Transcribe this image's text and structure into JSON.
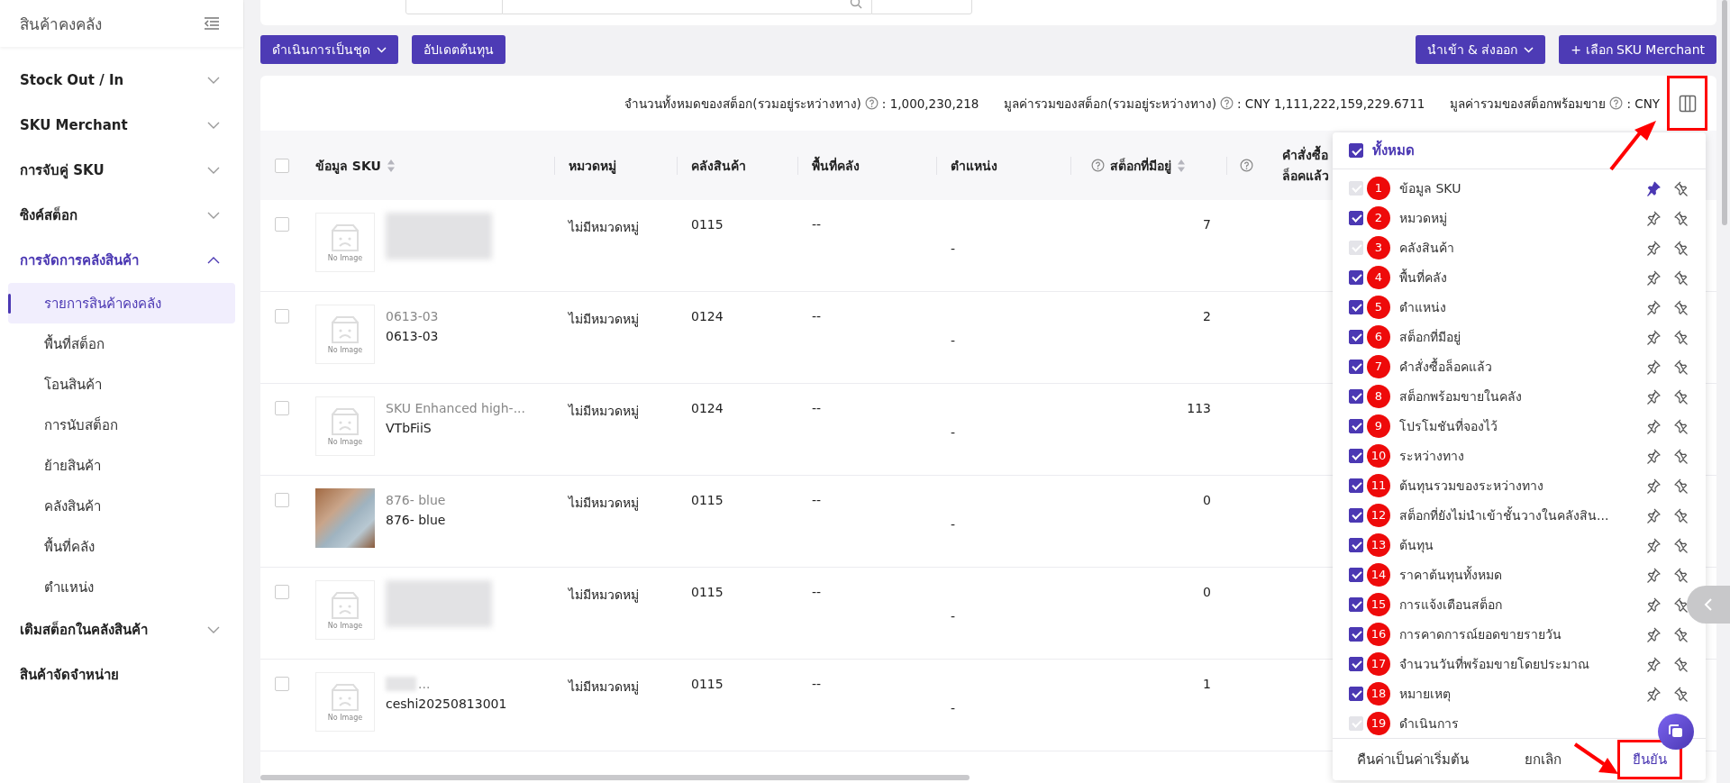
{
  "sidebar": {
    "title": "สินค้าคงคลัง",
    "items": [
      {
        "label": "Stock Out / In",
        "kind": "group",
        "expanded": false,
        "selected": false
      },
      {
        "label": "SKU Merchant",
        "kind": "group",
        "expanded": false,
        "selected": false
      },
      {
        "label": "การจับคู่ SKU",
        "kind": "group",
        "expanded": false,
        "selected": false
      },
      {
        "label": "ซิงค์สต็อก",
        "kind": "group",
        "expanded": false,
        "selected": false
      },
      {
        "label": "การจัดการคลังสินค้า",
        "kind": "group",
        "expanded": true,
        "selected": true,
        "children": [
          {
            "label": "รายการสินค้าคงคลัง",
            "selected": true
          },
          {
            "label": "พื้นที่สต็อก",
            "selected": false
          },
          {
            "label": "โอนสินค้า",
            "selected": false
          },
          {
            "label": "การนับสต็อก",
            "selected": false
          },
          {
            "label": "ย้ายสินค้า",
            "selected": false
          },
          {
            "label": "คลังสินค้า",
            "selected": false
          },
          {
            "label": "พื้นที่คลัง",
            "selected": false
          },
          {
            "label": "ตำแหน่ง",
            "selected": false
          }
        ]
      },
      {
        "label": "เติมสต็อกในคลังสินค้า",
        "kind": "group",
        "expanded": false,
        "selected": false
      },
      {
        "label": "สินค้าจัดจำหน่าย",
        "kind": "link",
        "selected": false
      }
    ]
  },
  "toolbar": {
    "left": [
      {
        "label": "ดำเนินการเป็นชุด",
        "dropdown": true
      },
      {
        "label": "อัปเดตต้นทุน",
        "dropdown": false
      }
    ],
    "right": [
      {
        "label": "นำเข้า & ส่งออก",
        "dropdown": true
      },
      {
        "label": "+ เลือก SKU Merchant",
        "dropdown": false
      }
    ]
  },
  "summary": [
    {
      "label": "จำนวนทั้งหมดของสต็อก(รวมอยู่ระหว่างทาง)",
      "value": ": 1,000,230,218"
    },
    {
      "label": "มูลค่ารวมของสต็อก(รวมอยู่ระหว่างทาง)",
      "value": ": CNY 1,111,222,159,229.6711"
    },
    {
      "label": "มูลค่ารวมของสต็อกพร้อมขาย",
      "value": ": CNY"
    }
  ],
  "column_settings_button": {
    "highlighted": true
  },
  "table": {
    "all_selected": false,
    "columns": [
      {
        "label": "ข้อมูล SKU",
        "help": false,
        "sortable": true
      },
      {
        "label": "หมวดหมู่",
        "help": false,
        "sortable": false
      },
      {
        "label": "คลังสินค้า",
        "help": false,
        "sortable": false
      },
      {
        "label": "พื้นที่คลัง",
        "help": false,
        "sortable": false
      },
      {
        "label": "ตำแหน่ง",
        "help": false,
        "sortable": false
      },
      {
        "label": "สต็อกที่มีอยู่",
        "help": true,
        "sortable": true
      },
      {
        "label": "คำสั่งซื้อล็อคแล้ว",
        "help": true,
        "sortable": false
      }
    ],
    "rows": [
      {
        "image": {
          "kind": "placeholder",
          "label": "No Image"
        },
        "title": {
          "kind": "blurred"
        },
        "category": "ไม่มีหมวดหมู่",
        "warehouse": "0115",
        "area": "--",
        "position": "-",
        "stock": "7",
        "selected": false
      },
      {
        "image": {
          "kind": "placeholder",
          "label": "No Image"
        },
        "title": {
          "kind": "text",
          "code": "0613-03",
          "name": "0613-03"
        },
        "category": "ไม่มีหมวดหมู่",
        "warehouse": "0124",
        "area": "--",
        "position": "-",
        "stock": "2",
        "selected": false
      },
      {
        "image": {
          "kind": "placeholder",
          "label": "No Image"
        },
        "title": {
          "kind": "text",
          "code": "SKU Enhanced high-...",
          "name": "VTbFiiS"
        },
        "category": "ไม่มีหมวดหมู่",
        "warehouse": "0124",
        "area": "--",
        "position": "-",
        "stock": "113",
        "selected": false
      },
      {
        "image": {
          "kind": "photo"
        },
        "title": {
          "kind": "text",
          "code": "876- blue",
          "name": "876- blue"
        },
        "category": "ไม่มีหมวดหมู่",
        "warehouse": "0115",
        "area": "--",
        "position": "-",
        "stock": "0",
        "selected": false
      },
      {
        "image": {
          "kind": "placeholder",
          "label": "No Image"
        },
        "title": {
          "kind": "blurred"
        },
        "category": "ไม่มีหมวดหมู่",
        "warehouse": "0115",
        "area": "--",
        "position": "-",
        "stock": "0",
        "selected": false
      },
      {
        "image": {
          "kind": "placeholder",
          "label": "No Image"
        },
        "title": {
          "kind": "blurred_prefix",
          "code": "...",
          "name": "ceshi20250813001"
        },
        "category": "ไม่มีหมวดหมู่",
        "warehouse": "0115",
        "area": "--",
        "position": "-",
        "stock": "1",
        "selected": false
      }
    ]
  },
  "column_panel": {
    "all_label": "ทั้งหมด",
    "all_checked": true,
    "items": [
      {
        "badge": "1",
        "label": "ข้อมูล SKU",
        "checked": true,
        "disabled": true,
        "pinned": true
      },
      {
        "badge": "2",
        "label": "หมวดหมู่",
        "checked": true,
        "disabled": false,
        "pinned": false
      },
      {
        "badge": "3",
        "label": "คลังสินค้า",
        "checked": true,
        "disabled": true,
        "pinned": false
      },
      {
        "badge": "4",
        "label": "พื้นที่คลัง",
        "checked": true,
        "disabled": false,
        "pinned": false
      },
      {
        "badge": "5",
        "label": "ตำแหน่ง",
        "checked": true,
        "disabled": false,
        "pinned": false
      },
      {
        "badge": "6",
        "label": "สต็อกที่มีอยู่",
        "checked": true,
        "disabled": false,
        "pinned": false
      },
      {
        "badge": "7",
        "label": "คำสั่งซื้อล็อคแล้ว",
        "checked": true,
        "disabled": false,
        "pinned": false
      },
      {
        "badge": "8",
        "label": "สต็อกพร้อมขายในคลัง",
        "checked": true,
        "disabled": false,
        "pinned": false
      },
      {
        "badge": "9",
        "label": "โปรโมชันที่จองไว้",
        "checked": true,
        "disabled": false,
        "pinned": false
      },
      {
        "badge": "10",
        "label": "ระหว่างทาง",
        "checked": true,
        "disabled": false,
        "pinned": false
      },
      {
        "badge": "11",
        "label": "ต้นทุนรวมของระหว่างทาง",
        "checked": true,
        "disabled": false,
        "pinned": false
      },
      {
        "badge": "12",
        "label": "สต็อกที่ยังไม่นำเข้าชั้นวางในคลังสิน...",
        "checked": true,
        "disabled": false,
        "pinned": false
      },
      {
        "badge": "13",
        "label": "ต้นทุน",
        "checked": true,
        "disabled": false,
        "pinned": false
      },
      {
        "badge": "14",
        "label": "ราคาต้นทุนทั้งหมด",
        "checked": true,
        "disabled": false,
        "pinned": false
      },
      {
        "badge": "15",
        "label": "การแจ้งเตือนสต็อก",
        "checked": true,
        "disabled": false,
        "pinned": false
      },
      {
        "badge": "16",
        "label": "การคาดการณ์ยอดขายรายวัน",
        "checked": true,
        "disabled": false,
        "pinned": false
      },
      {
        "badge": "17",
        "label": "จำนวนวันที่พร้อมขายโดยประมาณ",
        "checked": true,
        "disabled": false,
        "pinned": false
      },
      {
        "badge": "18",
        "label": "หมายเหตุ",
        "checked": true,
        "disabled": false,
        "pinned": false
      },
      {
        "badge": "19",
        "label": "ดำเนินการ",
        "checked": true,
        "disabled": true,
        "pinned": false
      }
    ],
    "buttons": [
      {
        "label": "คืนค่าเป็นค่าเริ่มต้น",
        "kind": "plain",
        "highlighted": false
      },
      {
        "label": "ยกเลิก",
        "kind": "plain",
        "highlighted": false
      },
      {
        "label": "ยืนยัน",
        "kind": "primary",
        "highlighted": true
      }
    ]
  }
}
